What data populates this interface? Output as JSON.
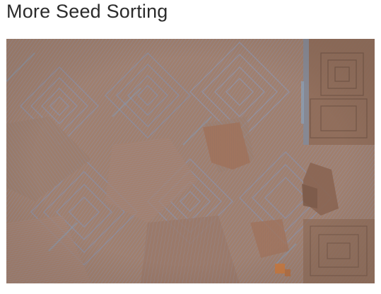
{
  "page": {
    "title": "More Seed Sorting"
  },
  "artwork": {
    "description_icon": "generative-pixel-sort-image",
    "colors": {
      "base": "#9e8273",
      "warm": "#a27a63",
      "cool": "#8a93a8",
      "blue_accent": "#7f9fbf",
      "dark": "#7d604f",
      "orange_accent": "#c9783d"
    }
  }
}
